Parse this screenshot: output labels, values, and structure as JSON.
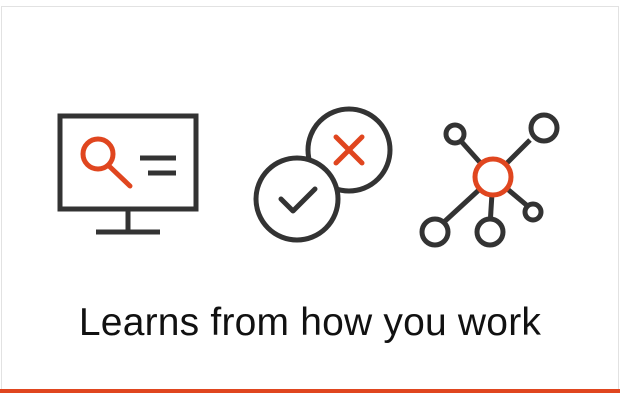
{
  "caption": "Learns from how you work",
  "icons": {
    "monitor": "monitor-search-icon",
    "decision": "check-cross-icon",
    "network": "network-nodes-icon"
  },
  "colors": {
    "accent": "#e0461f",
    "stroke": "#333333",
    "text": "#111111",
    "border": "#e2e2e2"
  }
}
